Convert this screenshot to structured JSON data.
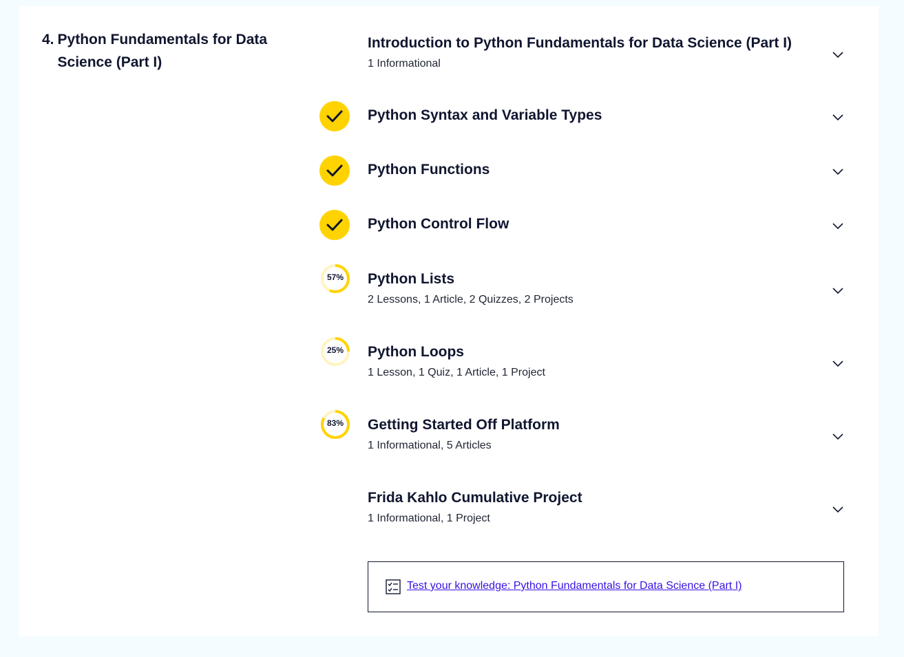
{
  "module": {
    "number": "4.",
    "title": "Python Fundamentals for Data Science (Part I)"
  },
  "colors": {
    "accent": "#ffd300",
    "accent_track": "#fff4bf",
    "text": "#10162f",
    "link": "#3a10e5",
    "page_bg": "#f5fcff"
  },
  "items": [
    {
      "title": "Introduction to Python Fundamentals for Data Science (Part I)",
      "subtitle": "1 Informational",
      "status": "none"
    },
    {
      "title": "Python Syntax and Variable Types",
      "subtitle": "",
      "status": "complete",
      "icon": "check-icon"
    },
    {
      "title": "Python Functions",
      "subtitle": "",
      "status": "complete",
      "icon": "check-icon"
    },
    {
      "title": "Python Control Flow",
      "subtitle": "",
      "status": "complete",
      "icon": "check-icon"
    },
    {
      "title": "Python Lists",
      "subtitle": "2 Lessons, 1 Article, 2 Quizzes, 2 Projects",
      "status": "progress",
      "progress_label": "57%",
      "progress": 0.57
    },
    {
      "title": "Python Loops",
      "subtitle": "1 Lesson, 1 Quiz, 1 Article, 1 Project",
      "status": "progress",
      "progress_label": "25%",
      "progress": 0.25
    },
    {
      "title": "Getting Started Off Platform",
      "subtitle": "1 Informational, 5 Articles",
      "status": "progress",
      "progress_label": "83%",
      "progress": 0.83
    },
    {
      "title": "Frida Kahlo Cumulative Project",
      "subtitle": "1 Informational, 1 Project",
      "status": "none"
    }
  ],
  "quiz": {
    "link_text": "Test your knowledge: Python Fundamentals for Data Science (Part I)",
    "icon": "checklist-icon"
  }
}
